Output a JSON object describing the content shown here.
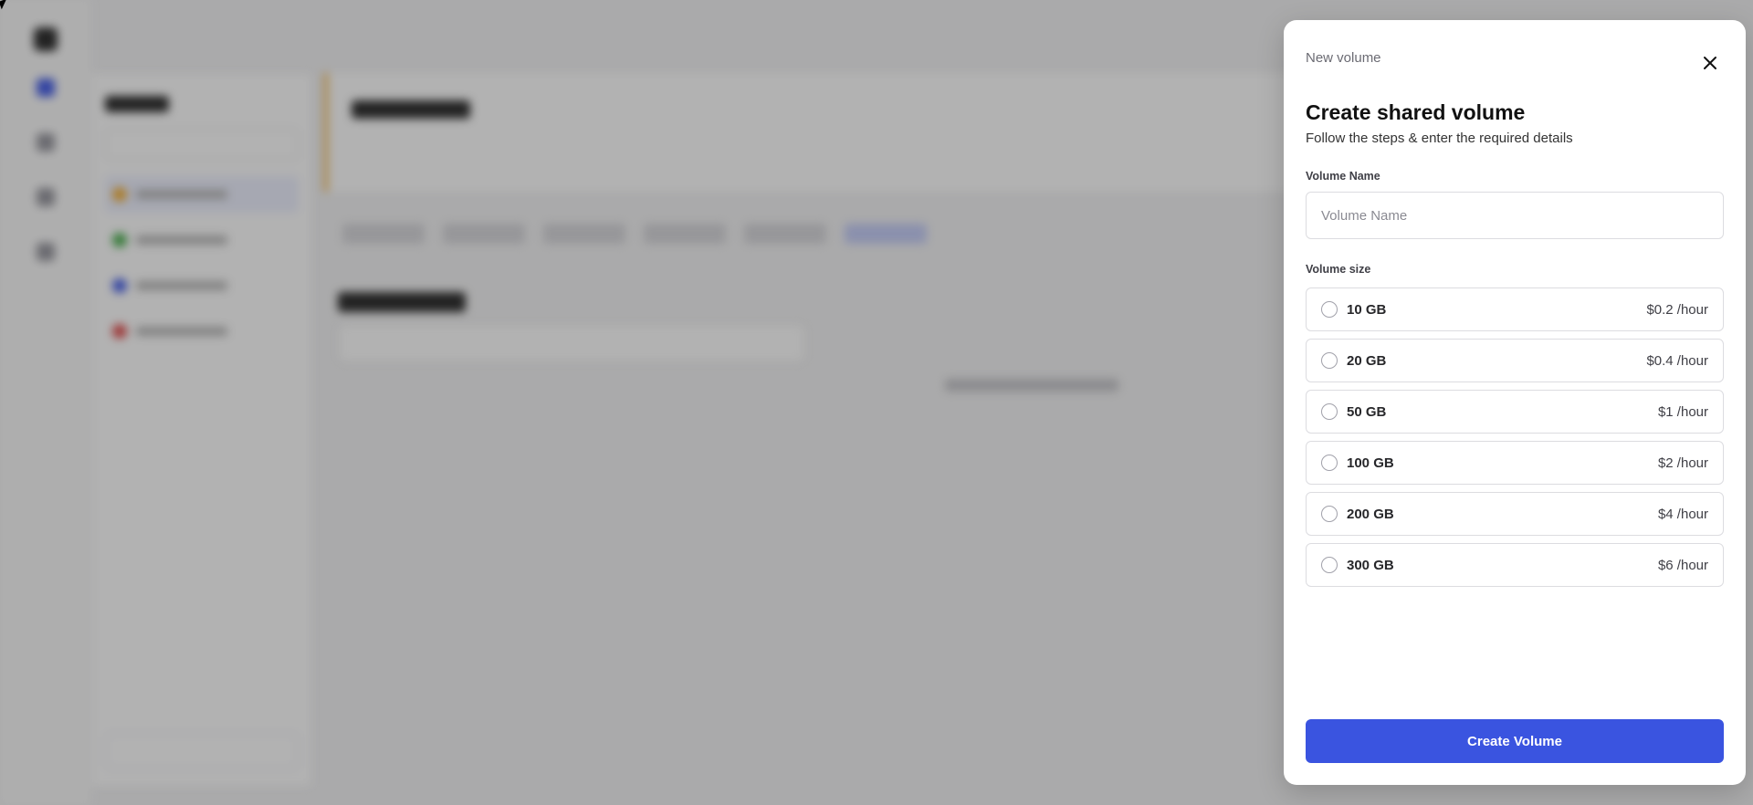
{
  "drawer": {
    "kicker": "New volume",
    "title": "Create shared volume",
    "subtitle": "Follow the steps & enter the required details",
    "name_label": "Volume Name",
    "name_placeholder": "Volume Name",
    "name_value": "",
    "size_label": "Volume size",
    "options": [
      {
        "size": "10 GB",
        "price": "$0.2 /hour"
      },
      {
        "size": "20 GB",
        "price": "$0.4 /hour"
      },
      {
        "size": "50 GB",
        "price": "$1 /hour"
      },
      {
        "size": "100 GB",
        "price": "$2 /hour"
      },
      {
        "size": "200 GB",
        "price": "$4 /hour"
      },
      {
        "size": "300 GB",
        "price": "$6 /hour"
      }
    ],
    "create_label": "Create Volume"
  },
  "colors": {
    "accent": "#3a54e0",
    "overlay": "rgba(0,0,0,0.30)"
  },
  "icons": {
    "close": "close-icon"
  }
}
